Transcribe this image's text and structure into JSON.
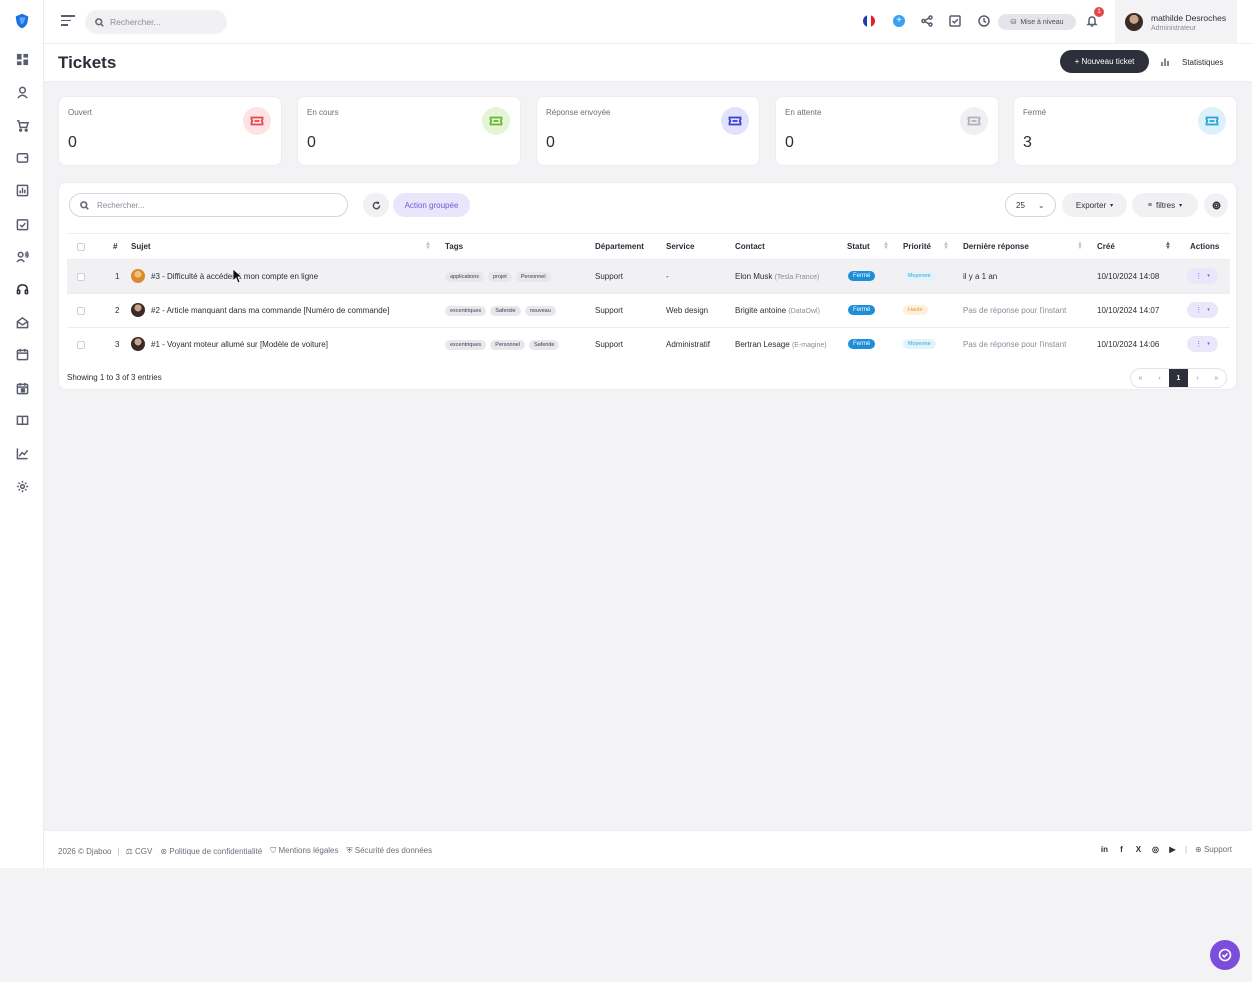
{
  "topbar": {
    "search_placeholder": "Rechercher...",
    "upgrade_label": "Mise à niveau",
    "notification_count": "1",
    "user_name": "mathilde Desroches",
    "user_role": "Administrateur"
  },
  "page": {
    "title": "Tickets",
    "new_ticket_label": "+ Nouveau ticket",
    "stats_label": "Statistiques"
  },
  "cards": [
    {
      "label": "Ouvert",
      "value": "0",
      "color": "#e5484d",
      "bg": "#fde3e4"
    },
    {
      "label": "En cours",
      "value": "0",
      "color": "#6bb82f",
      "bg": "#e6f5d9"
    },
    {
      "label": "Réponse envoyée",
      "value": "0",
      "color": "#3b3fd1",
      "bg": "#e1e2fb"
    },
    {
      "label": "En attente",
      "value": "0",
      "color": "#b0b1bb",
      "bg": "#f0f0f3"
    },
    {
      "label": "Fermé",
      "value": "3",
      "color": "#2aa2dc",
      "bg": "#ddf1fb"
    }
  ],
  "toolbar": {
    "search_placeholder": "Rechercher...",
    "group_action_label": "Action groupée",
    "per_page": "25",
    "export_label": "Exporter",
    "filters_label": "filtres"
  },
  "columns": {
    "num": "#",
    "subject": "Sujet",
    "tags": "Tags",
    "department": "Département",
    "service": "Service",
    "contact": "Contact",
    "status": "Statut",
    "priority": "Priorité",
    "last_reply": "Dernière réponse",
    "created": "Créé",
    "actions": "Actions"
  },
  "rows": [
    {
      "num": "1",
      "subject": "#3 - Difficulté à accéder à mon compte en ligne",
      "tags": [
        "applications",
        "projet",
        "Personnel"
      ],
      "department": "Support",
      "service": "-",
      "contact": "Elon Musk",
      "company": "(Tesla France)",
      "status": "Fermé",
      "priority": "Moyenne",
      "last_reply": "il y a 1 an",
      "created": "10/10/2024 14:08"
    },
    {
      "num": "2",
      "subject": "#2 - Article manquant dans ma commande [Numéro de commande]",
      "tags": [
        "excentriques",
        "Saferide",
        "nouveau"
      ],
      "department": "Support",
      "service": "Web design",
      "contact": "Brigite antoine",
      "company": "(DataOwl)",
      "status": "Fermé",
      "priority": "Haute",
      "last_reply": "Pas de réponse pour l'instant",
      "created": "10/10/2024 14:07"
    },
    {
      "num": "3",
      "subject": "#1 - Voyant moteur allumé sur [Modèle de voiture]",
      "tags": [
        "excentriques",
        "Personnel",
        "Saferide"
      ],
      "department": "Support",
      "service": "Administratif",
      "contact": "Bertran Lesage",
      "company": "(E-magine)",
      "status": "Fermé",
      "priority": "Moyenne",
      "last_reply": "Pas de réponse pour l'instant",
      "created": "10/10/2024 14:06"
    }
  ],
  "table_footer": {
    "showing": "Showing 1 to 3 of 3 entries",
    "pager": [
      "«",
      "‹",
      "1",
      "›",
      "»"
    ]
  },
  "footer": {
    "copyright": "2026 © Djaboo",
    "links": [
      "CGV",
      "Politique de confidentialité",
      "Mentions légales",
      "Sécurité des données"
    ],
    "support": "Support"
  }
}
